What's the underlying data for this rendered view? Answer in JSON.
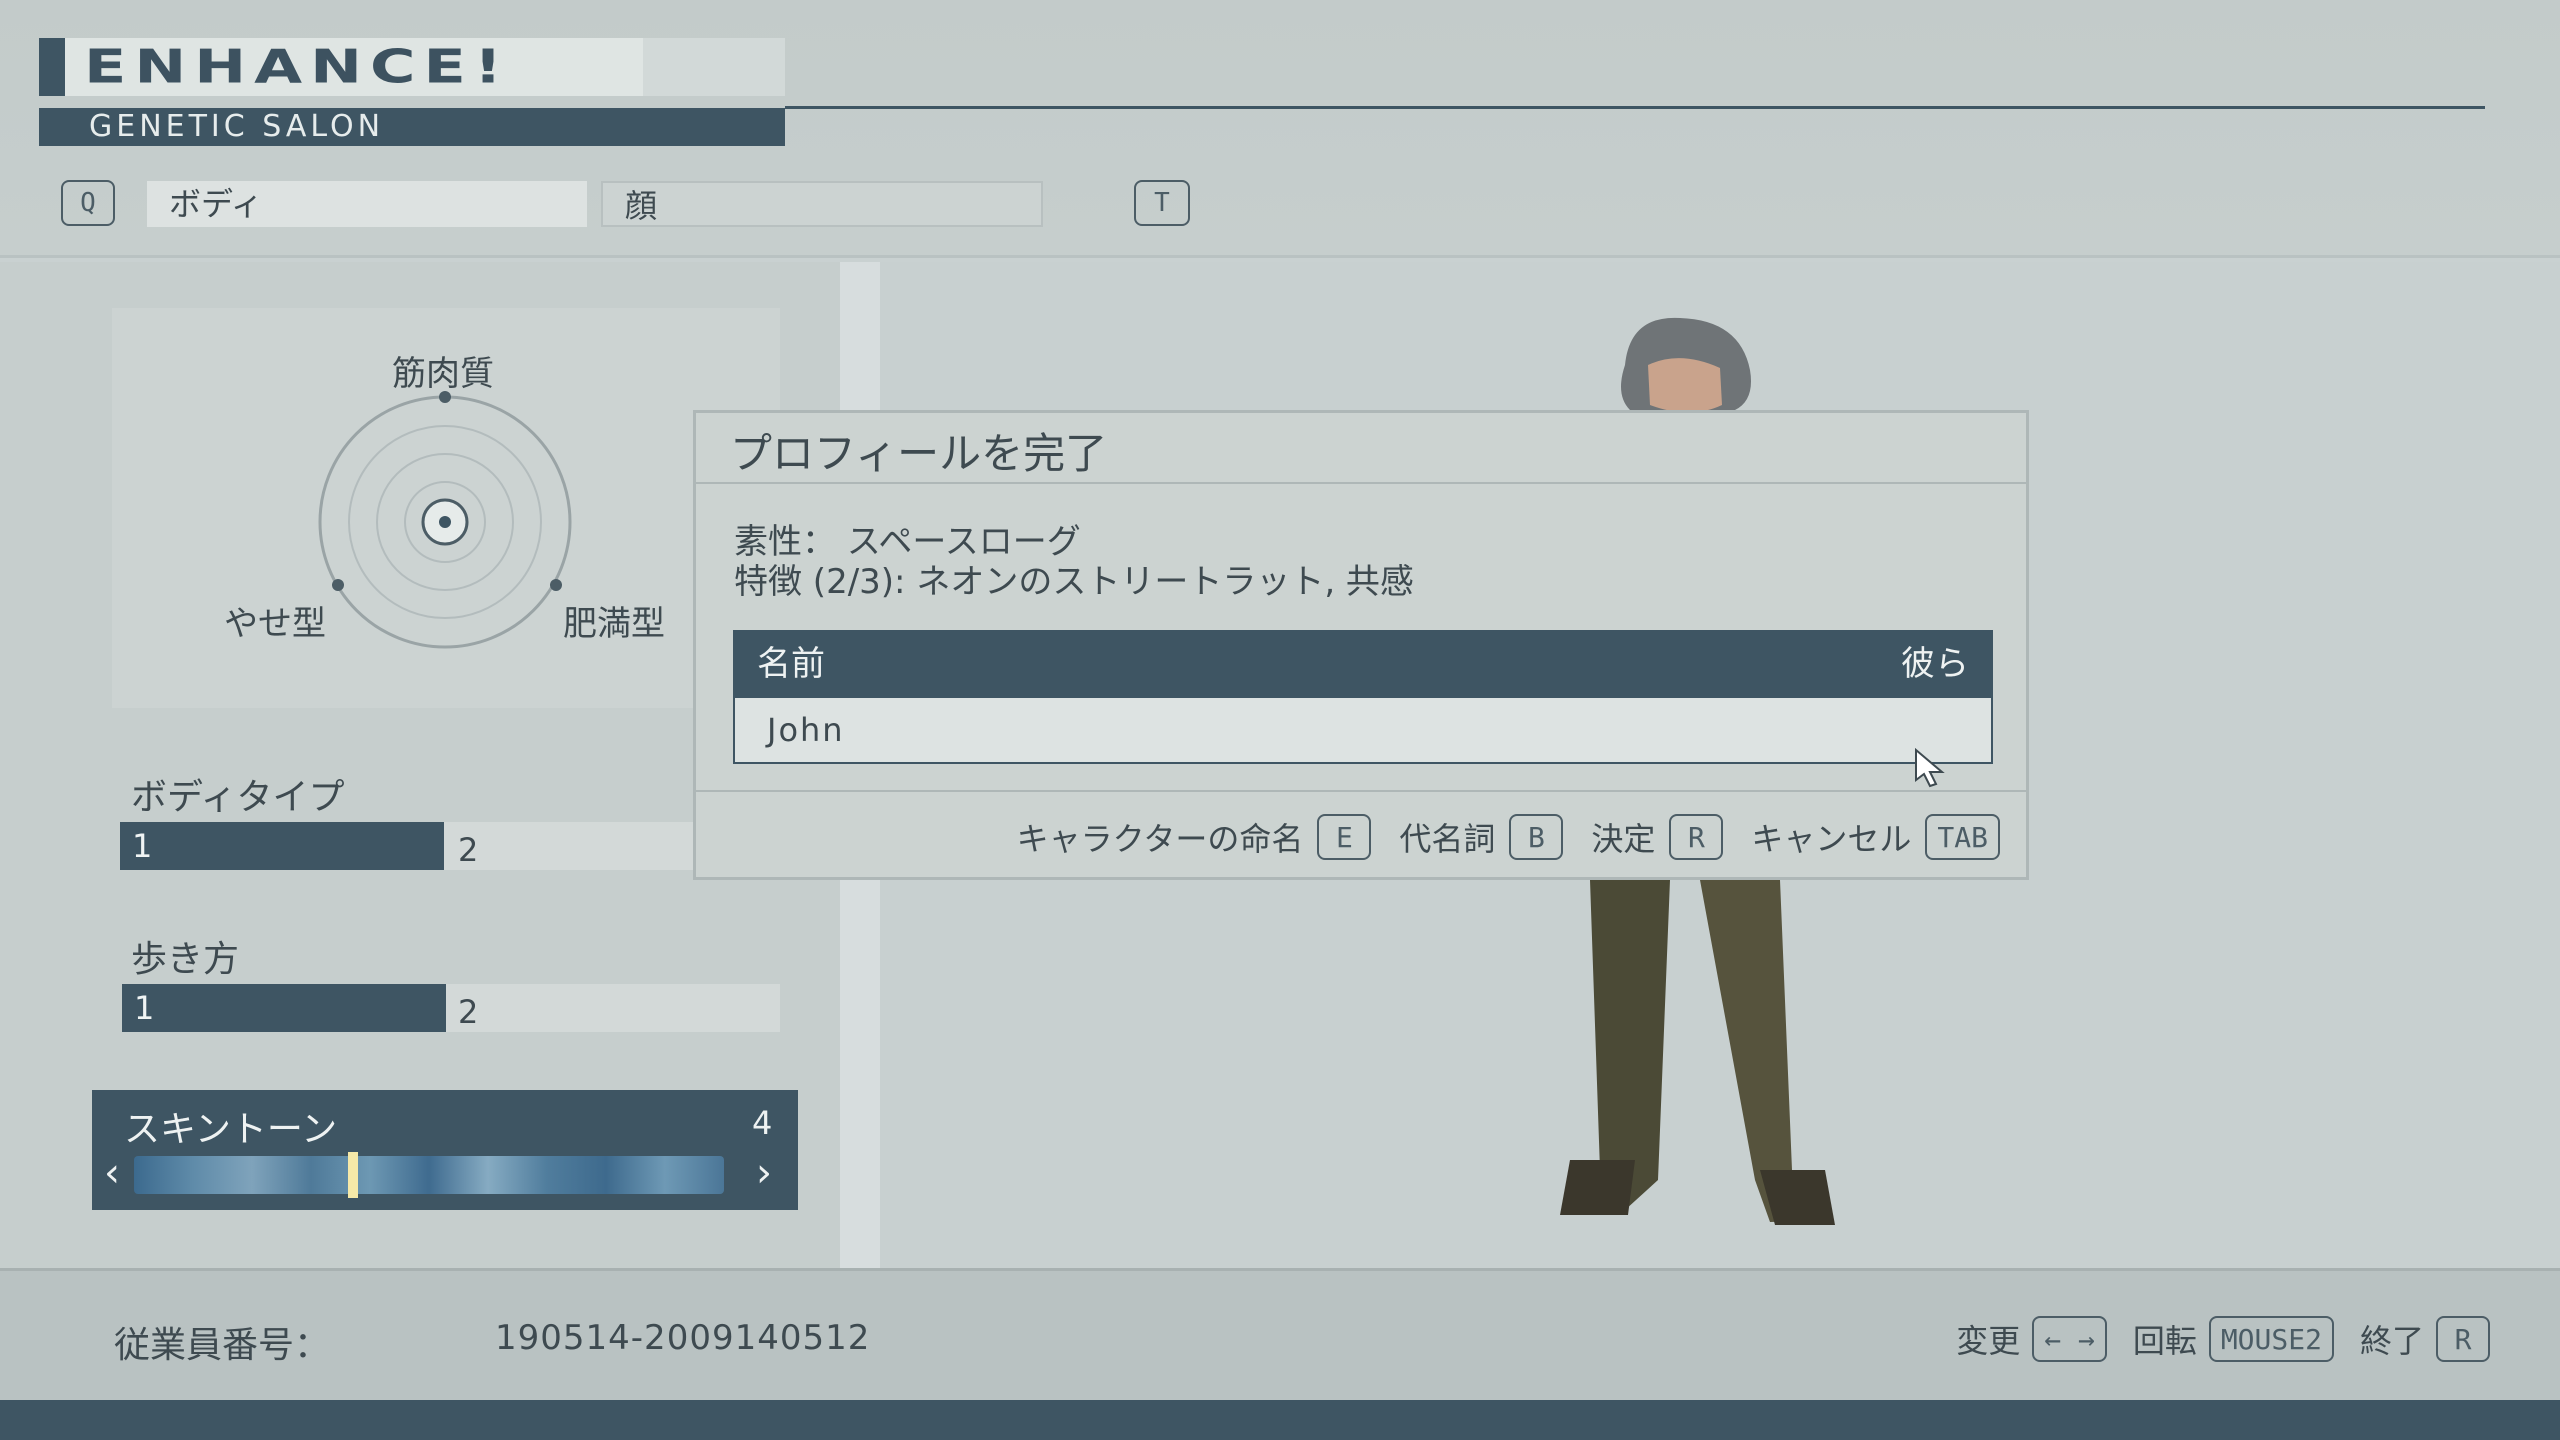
{
  "header": {
    "logo": "ENHANCE!",
    "subtitle": "GENETIC SALON",
    "key_prev": "Q",
    "key_next": "T",
    "tabs": [
      {
        "label": "ボディ",
        "active": true
      },
      {
        "label": "顔",
        "active": false
      }
    ]
  },
  "body_shape": {
    "labels": {
      "top": "筋肉質",
      "left": "やせ型",
      "right": "肥満型"
    }
  },
  "sliders": {
    "body_type": {
      "title": "ボディタイプ",
      "value": "1",
      "max_label": "2"
    },
    "walk_style": {
      "title": "歩き方",
      "value": "1",
      "max_label": "2"
    },
    "skin_tone": {
      "title": "スキントーン",
      "value": "4",
      "prev_label": "‹",
      "next_label": "›"
    }
  },
  "modal": {
    "title": "プロフィールを完了",
    "background_line": "素性： スペースローグ",
    "traits_line": "特徴 (2/3): ネオンのストリートラット, 共感",
    "name_header": "名前",
    "pronoun": "彼ら",
    "name_value": "John",
    "actions": [
      {
        "label": "キャラクターの命名",
        "key": "E"
      },
      {
        "label": "代名詞",
        "key": "B"
      },
      {
        "label": "決定",
        "key": "R"
      },
      {
        "label": "キャンセル",
        "key": "TAB"
      }
    ]
  },
  "footer": {
    "employee_label": "従業員番号：",
    "employee_value": "190514-2009140512",
    "actions": [
      {
        "label": "変更",
        "key": "← →"
      },
      {
        "label": "回転",
        "key": "MOUSE2"
      },
      {
        "label": "終了",
        "key": "R"
      }
    ]
  },
  "colors": {
    "accent": "#3e5563",
    "background": "#c9d1d1",
    "panel": "#ccd3d2"
  }
}
